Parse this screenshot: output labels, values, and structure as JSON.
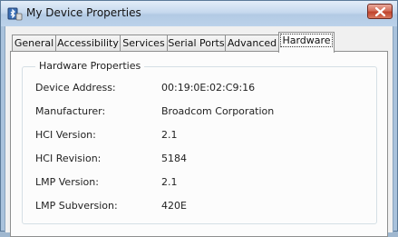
{
  "window": {
    "title": "My Device Properties",
    "icon": "bluetooth-device-icon",
    "close_icon": "close-icon"
  },
  "tabs": [
    {
      "label": "General",
      "active": false
    },
    {
      "label": "Accessibility",
      "active": false
    },
    {
      "label": "Services",
      "active": false
    },
    {
      "label": "Serial Ports",
      "active": false
    },
    {
      "label": "Advanced",
      "active": false
    },
    {
      "label": "Hardware",
      "active": true
    }
  ],
  "hardware": {
    "group_title": "Hardware Properties",
    "properties": [
      {
        "label": "Device Address:",
        "value": "00:19:0E:02:C9:16"
      },
      {
        "label": "Manufacturer:",
        "value": "Broadcom Corporation"
      },
      {
        "label": "HCI Version:",
        "value": "2.1"
      },
      {
        "label": "HCI Revision:",
        "value": "5184"
      },
      {
        "label": "LMP Version:",
        "value": "2.1"
      },
      {
        "label": "LMP Subversion:",
        "value": "420E"
      }
    ]
  },
  "colors": {
    "close_button": "#c0432c",
    "tab_border": "#8e8f8f"
  }
}
